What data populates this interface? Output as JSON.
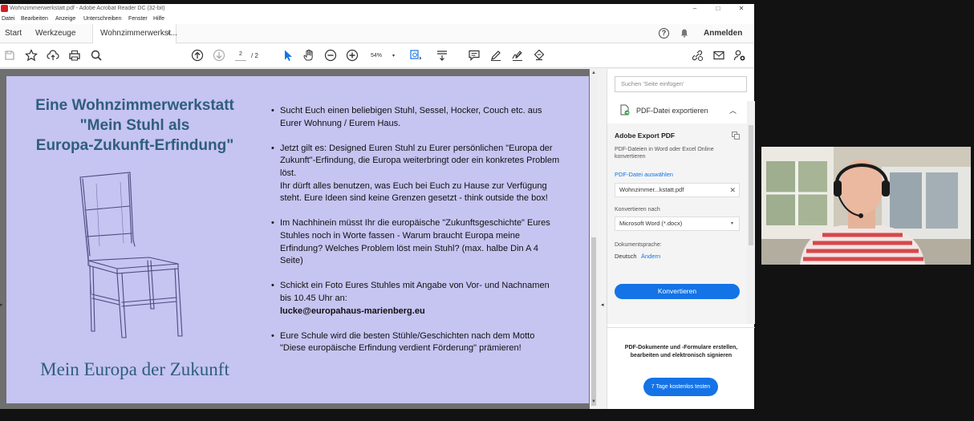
{
  "window": {
    "title": "Wohnzimmerwerkstatt.pdf - Adobe Acrobat Reader DC (32-bit)",
    "controls": {
      "minimize": "–",
      "maximize": "□",
      "close": "✕"
    }
  },
  "menu": {
    "items": [
      "Datei",
      "Bearbeiten",
      "Anzeige",
      "Unterschreiben",
      "Fenster",
      "Hilfe"
    ]
  },
  "tabs": {
    "home": "Start",
    "tools": "Werkzeuge",
    "document": "Wohnzimmerwerkst...",
    "close_glyph": "×"
  },
  "header_right": {
    "help_glyph": "?",
    "sign_in": "Anmelden"
  },
  "toolbar": {
    "page_current": "2",
    "page_total": "/  2",
    "zoom": "54%",
    "caret": "▾",
    "icons": [
      "save-icon",
      "star-icon",
      "upload-icon",
      "print-icon",
      "magnify-icon",
      "page-up-icon",
      "page-down-icon",
      "select-cursor-icon",
      "hand-icon",
      "zoom-out-icon",
      "zoom-in-icon",
      "marquee-zoom-icon",
      "scroll-mode-icon",
      "comment-icon",
      "highlight-pen-icon",
      "sign-icon",
      "stamp-icon",
      "share-link-icon",
      "mail-icon",
      "add-user-icon"
    ]
  },
  "document": {
    "title_lines": [
      "Eine Wohnzimmerwerkstatt",
      "\"Mein Stuhl als",
      "Europa-Zukunft-Erfindung\""
    ],
    "footer": "Mein Europa der Zukunft",
    "bullets": [
      {
        "text": "Sucht Euch einen beliebigen Stuhl, Sessel, Hocker, Couch etc. aus Eurer Wohnung / Eurem Haus."
      },
      {
        "text": "Jetzt gilt es: Designed Euren Stuhl zu Eurer persönlichen \"Europa der Zukunft\"-Erfindung, die Europa weiterbringt oder ein konkretes Problem löst.",
        "text2": "Ihr dürft alles benutzen, was Euch bei Euch zu Hause zur Verfügung steht. Eure Ideen sind keine Grenzen gesetzt - think outside the box!"
      },
      {
        "text": "Im Nachhinein müsst Ihr die europäische \"Zukunftsgeschichte\" Eures Stuhles noch in Worte fassen - Warum braucht Europa meine Erfindung? Welches Problem löst mein Stuhl? (max. halbe Din A 4 Seite)"
      },
      {
        "text": "Schickt ein Foto Eures Stuhles mit Angabe von Vor- und Nachnamen bis 10.45 Uhr an:",
        "bold": "lucke@europahaus-marienberg.eu"
      },
      {
        "text": "Eure Schule wird die besten Stühle/Geschichten nach dem Motto \"Diese europäische Erfindung verdient Förderung\" prämieren!"
      }
    ]
  },
  "right_panel": {
    "search_placeholder": "Suchen 'Seite einfügen'",
    "export_section_title": "PDF-Datei exportieren",
    "export_title": "Adobe Export PDF",
    "export_desc": "PDF-Dateien in Word oder Excel Online konvertieren",
    "choose_file": "PDF-Datei auswählen",
    "file_name": "Wohnzimmer...kstatt.pdf",
    "convert_to_label": "Konvertieren nach",
    "format": "Microsoft Word (*.docx)",
    "doc_lang_label": "Dokumentsprache:",
    "doc_lang": "Deutsch",
    "change_link": "Ändern",
    "convert_button": "Konvertieren",
    "promo_text": "PDF-Dokumente und -Formulare erstellen, bearbeiten und elektronisch signieren",
    "trial_button": "7 Tage kostenlos testen"
  }
}
